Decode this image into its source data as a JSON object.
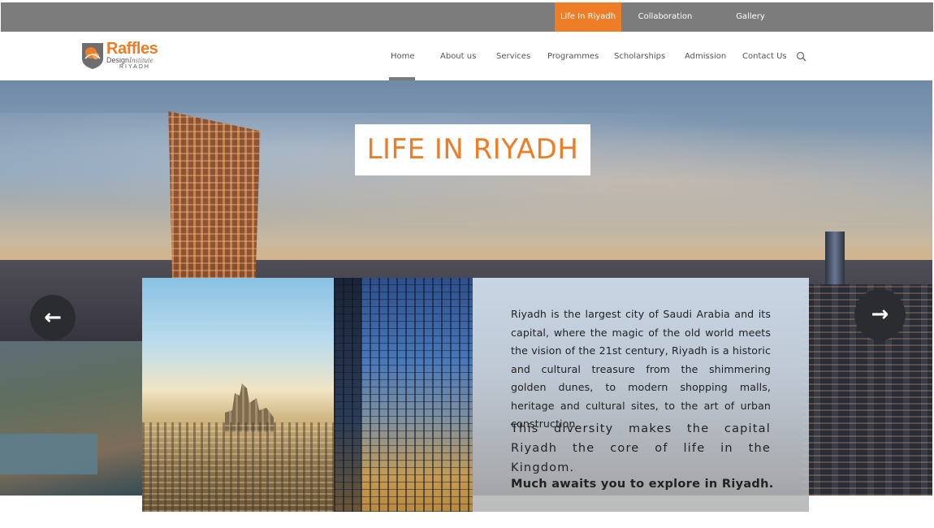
{
  "topbar": {
    "links": [
      "Life In Riyadh",
      "Collaboration",
      "Gallery"
    ]
  },
  "logo": {
    "brand": "Raffles",
    "subtitle_main": "Design",
    "subtitle_script": "Institute",
    "city": "RIYADH"
  },
  "nav": {
    "items": [
      "Home",
      "About us",
      "Services",
      "Programmes",
      "Scholarships",
      "Admission",
      "Contact Us"
    ],
    "active": "Home"
  },
  "hero": {
    "title": "LIFE IN RIYADH"
  },
  "content": {
    "paragraph1": "Riyadh is the largest city of Saudi Arabia and its capital, where the magic of the old world meets the vision of the 21st century, Riyadh is a historic and cultural treasure from the shimmering golden dunes, to modern shopping malls, heritage and cultural sites, to the art of urban construction.",
    "paragraph2": "This diversity makes the capital Riyadh the core of life in the Kingdom.",
    "paragraph3": "Much awaits you to explore in Riyadh."
  },
  "colors": {
    "accent": "#ee7d27",
    "topbar": "#7c7c7c",
    "arrow": "#2b2c30"
  },
  "icons": {
    "search": "search-icon",
    "prev": "arrow-left-icon",
    "next": "arrow-right-icon"
  }
}
